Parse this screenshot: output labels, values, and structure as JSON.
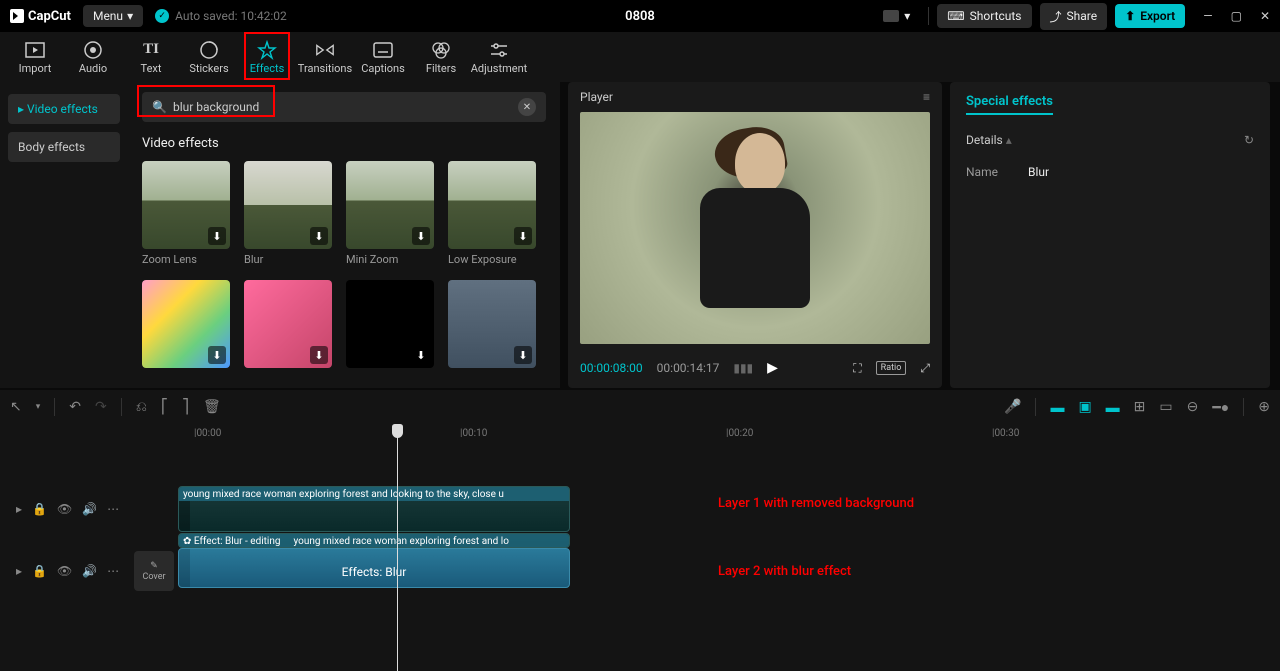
{
  "topbar": {
    "logo": "CapCut",
    "menu": "Menu",
    "autosaved": "Auto saved: 10:42:02",
    "project": "0808",
    "shortcuts": "Shortcuts",
    "share": "Share",
    "export": "Export"
  },
  "tools": [
    {
      "label": "Import"
    },
    {
      "label": "Audio"
    },
    {
      "label": "Text"
    },
    {
      "label": "Stickers"
    },
    {
      "label": "Effects"
    },
    {
      "label": "Transitions"
    },
    {
      "label": "Captions"
    },
    {
      "label": "Filters"
    },
    {
      "label": "Adjustment"
    }
  ],
  "sidebar": {
    "items": [
      "Video effects",
      "Body effects"
    ]
  },
  "search": {
    "value": "blur background"
  },
  "effects": {
    "section": "Video effects",
    "items": [
      {
        "label": "Zoom Lens"
      },
      {
        "label": "Blur"
      },
      {
        "label": "Mini Zoom"
      },
      {
        "label": "Low Exposure"
      },
      {
        "label": ""
      },
      {
        "label": ""
      },
      {
        "label": ""
      },
      {
        "label": ""
      }
    ]
  },
  "player": {
    "title": "Player",
    "current": "00:00:08:00",
    "duration": "00:00:14:17",
    "ratio": "Ratio"
  },
  "inspector": {
    "title": "Special effects",
    "details": "Details",
    "nameKey": "Name",
    "nameVal": "Blur"
  },
  "ruler": [
    "|00:00",
    "|00:10",
    "|00:20",
    "|00:30"
  ],
  "tracks": {
    "clip1_header": "young mixed race woman exploring forest and looking to the sky, close u",
    "clip2_header_a": "✿ Effect: Blur - editing",
    "clip2_header_b": "young mixed race woman exploring forest and lo",
    "clip2_center": "Effects:   Blur",
    "cover": "Cover"
  },
  "annotations": {
    "a1": "Layer 1 with removed background",
    "a2": "Layer 2 with blur effect"
  }
}
